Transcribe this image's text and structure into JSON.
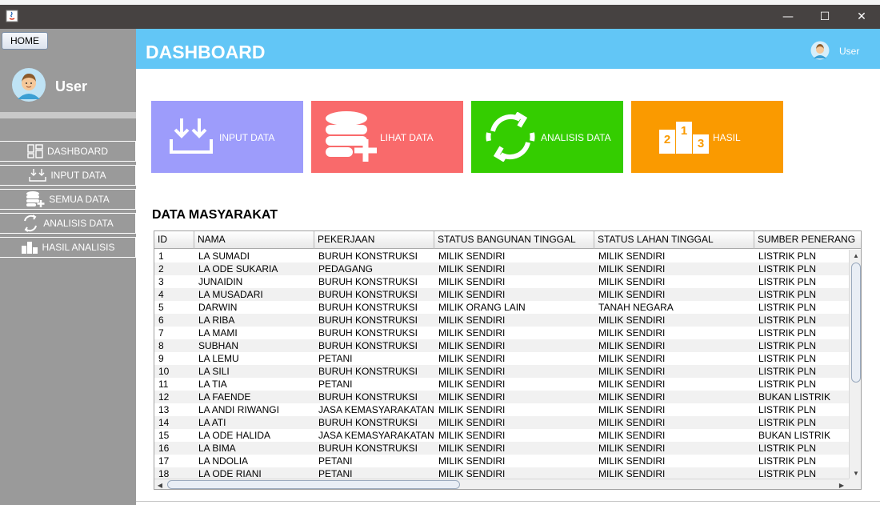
{
  "window": {
    "minimize_glyph": "—",
    "maximize_glyph": "☐",
    "close_glyph": "✕"
  },
  "sidebar": {
    "home_label": "HOME",
    "user_name": "User",
    "items": [
      {
        "label": "DASHBOARD",
        "icon": "dashboard-grid-icon"
      },
      {
        "label": "INPUT DATA",
        "icon": "download-tray-icon"
      },
      {
        "label": "SEMUA DATA",
        "icon": "database-plus-icon"
      },
      {
        "label": "ANALISIS DATA",
        "icon": "refresh-cycle-icon"
      },
      {
        "label": "HASIL ANALISIS",
        "icon": "podium-icon"
      }
    ]
  },
  "header": {
    "title": "DASHBOARD",
    "user_label": "User"
  },
  "tiles": [
    {
      "label": "INPUT DATA",
      "icon": "download-tray-icon",
      "color": "#9d9cfb"
    },
    {
      "label": "LIHAT DATA",
      "icon": "database-plus-icon",
      "color": "#f96a6b"
    },
    {
      "label": "ANALISIS DATA",
      "icon": "refresh-cycle-icon",
      "color": "#34cd00"
    },
    {
      "label": "HASIL",
      "icon": "podium-icon",
      "color": "#fa9a00"
    }
  ],
  "table": {
    "title": "DATA MASYARAKAT",
    "columns": [
      "ID",
      "NAMA",
      "PEKERJAAN",
      "STATUS BANGUNAN TINGGAL",
      "STATUS LAHAN TINGGAL",
      "SUMBER PENERANG"
    ],
    "rows": [
      [
        "1",
        "LA SUMADI",
        "BURUH KONSTRUKSI",
        "MILIK SENDIRI",
        "MILIK SENDIRI",
        "LISTRIK PLN"
      ],
      [
        "2",
        "LA ODE SUKARIA",
        "PEDAGANG",
        "MILIK SENDIRI",
        "MILIK SENDIRI",
        "LISTRIK PLN"
      ],
      [
        "3",
        "JUNAIDIN",
        "BURUH KONSTRUKSI",
        "MILIK SENDIRI",
        "MILIK SENDIRI",
        "LISTRIK PLN"
      ],
      [
        "4",
        "LA MUSADARI",
        "BURUH KONSTRUKSI",
        "MILIK SENDIRI",
        "MILIK SENDIRI",
        "LISTRIK PLN"
      ],
      [
        "5",
        "DARWIN",
        "BURUH KONSTRUKSI",
        "MILIK ORANG LAIN",
        "TANAH NEGARA",
        "LISTRIK PLN"
      ],
      [
        "6",
        "LA RIBA",
        "BURUH KONSTRUKSI",
        "MILIK SENDIRI",
        "MILIK SENDIRI",
        "LISTRIK PLN"
      ],
      [
        "7",
        "LA MAMI",
        "BURUH KONSTRUKSI",
        "MILIK SENDIRI",
        "MILIK SENDIRI",
        "LISTRIK PLN"
      ],
      [
        "8",
        "SUBHAN",
        "BURUH KONSTRUKSI",
        "MILIK SENDIRI",
        "MILIK SENDIRI",
        "LISTRIK PLN"
      ],
      [
        "9",
        "LA LEMU",
        "PETANI",
        "MILIK SENDIRI",
        "MILIK SENDIRI",
        "LISTRIK PLN"
      ],
      [
        "10",
        "LA SILI",
        "BURUH KONSTRUKSI",
        "MILIK SENDIRI",
        "MILIK SENDIRI",
        "LISTRIK PLN"
      ],
      [
        "11",
        "LA TIA",
        "PETANI",
        "MILIK SENDIRI",
        "MILIK SENDIRI",
        "LISTRIK PLN"
      ],
      [
        "12",
        "LA FAENDE",
        "BURUH KONSTRUKSI",
        "MILIK SENDIRI",
        "MILIK SENDIRI",
        "BUKAN LISTRIK"
      ],
      [
        "13",
        "LA ANDI RIWANGI",
        "JASA KEMASYARAKATAN",
        "MILIK SENDIRI",
        "MILIK SENDIRI",
        "LISTRIK PLN"
      ],
      [
        "14",
        "LA ATI",
        "BURUH KONSTRUKSI",
        "MILIK SENDIRI",
        "MILIK SENDIRI",
        "LISTRIK PLN"
      ],
      [
        "15",
        "LA ODE HALIDA",
        "JASA KEMASYARAKATAN",
        "MILIK SENDIRI",
        "MILIK SENDIRI",
        "BUKAN LISTRIK"
      ],
      [
        "16",
        "LA BIMA",
        "BURUH KONSTRUKSI",
        "MILIK SENDIRI",
        "MILIK SENDIRI",
        "LISTRIK PLN"
      ],
      [
        "17",
        "LA NDOLIA",
        "PETANI",
        "MILIK SENDIRI",
        "MILIK SENDIRI",
        "LISTRIK PLN"
      ],
      [
        "18",
        "LA ODE RIANI",
        "PETANI",
        "MILIK SENDIRI",
        "MILIK SENDIRI",
        "LISTRIK PLN"
      ]
    ]
  },
  "scroll": {
    "up_glyph": "▲",
    "down_glyph": "▼",
    "left_glyph": "◀",
    "right_glyph": "▶"
  }
}
